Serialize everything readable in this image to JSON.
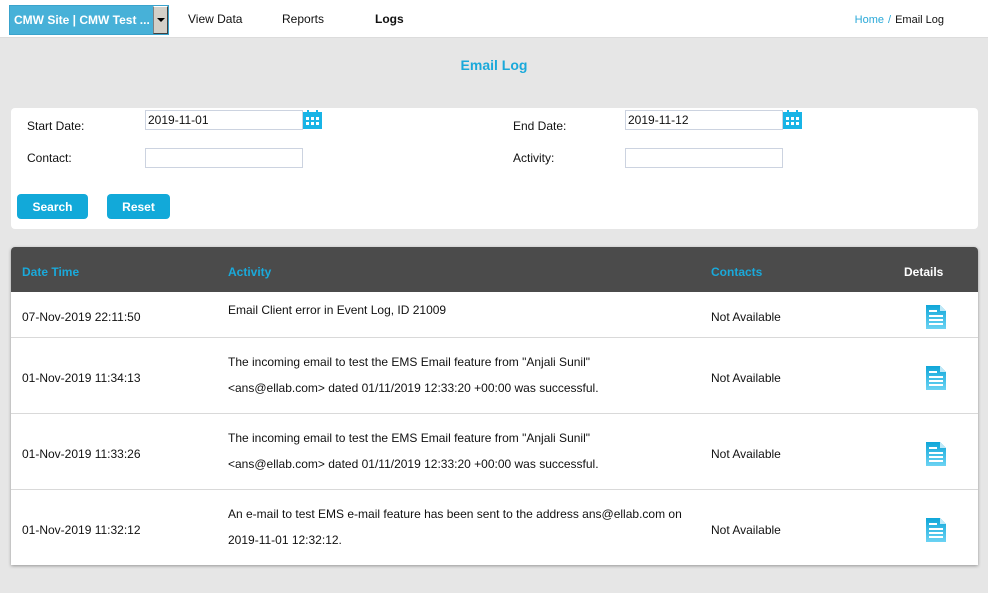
{
  "topbar": {
    "site_selector": "CMW Site | CMW Test ...",
    "nav": [
      {
        "label": "View Data",
        "active": false
      },
      {
        "label": "Reports",
        "active": false
      },
      {
        "label": "Logs",
        "active": true
      }
    ],
    "breadcrumb": {
      "home": "Home",
      "separator": "/",
      "current": "Email Log"
    }
  },
  "page": {
    "title": "Email Log"
  },
  "filters": {
    "start_date_label": "Start Date:",
    "start_date_value": "2019-11-01",
    "end_date_label": "End Date:",
    "end_date_value": "2019-11-12",
    "contact_label": "Contact:",
    "contact_value": "",
    "activity_label": "Activity:",
    "activity_value": "",
    "search_button": "Search",
    "reset_button": "Reset"
  },
  "table": {
    "columns": {
      "datetime": "Date Time",
      "activity": "Activity",
      "contacts": "Contacts",
      "details": "Details"
    },
    "rows": [
      {
        "datetime": "07-Nov-2019 22:11:50",
        "activity_lines": [
          "Email Client error in Event Log, ID 21009"
        ],
        "contacts": "Not Available",
        "details_icon": "document-icon"
      },
      {
        "datetime": "01-Nov-2019 11:34:13",
        "activity_lines": [
          "The incoming email to test the EMS Email feature from \"Anjali Sunil\"",
          "<ans@ellab.com> dated 01/11/2019 12:33:20 +00:00 was successful."
        ],
        "contacts": "Not Available",
        "details_icon": "document-icon"
      },
      {
        "datetime": "01-Nov-2019 11:33:26",
        "activity_lines": [
          "The incoming email to test the EMS Email feature from \"Anjali Sunil\"",
          "<ans@ellab.com> dated 01/11/2019 12:33:20 +00:00 was successful."
        ],
        "contacts": "Not Available",
        "details_icon": "document-icon"
      },
      {
        "datetime": "01-Nov-2019 11:32:12",
        "activity_lines": [
          "An e-mail to test EMS e-mail feature has been sent to the address ans@ellab.com on",
          "2019-11-01 12:32:12."
        ],
        "contacts": "Not Available",
        "details_icon": "document-icon"
      }
    ]
  },
  "colors": {
    "accent": "#1aa9da",
    "header_bg": "#4b4b4b",
    "page_bg": "#e6e6e6"
  }
}
